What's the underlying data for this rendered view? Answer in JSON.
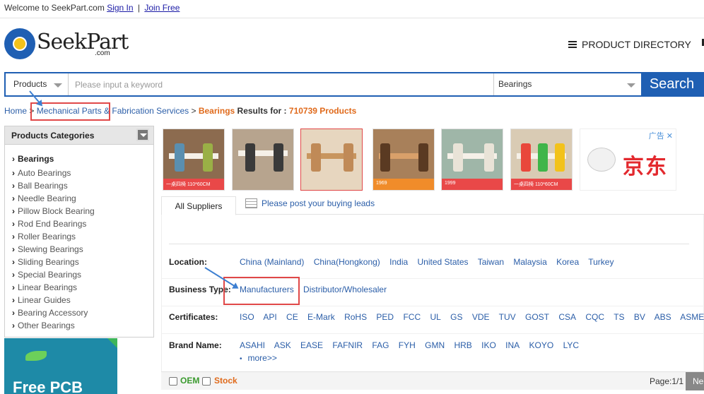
{
  "topbar": {
    "welcome": "Welcome to SeekPart.com",
    "sign_in": "Sign In",
    "sep": "|",
    "join": "Join Free"
  },
  "logo": {
    "text": "SeekPart",
    "sub": ".com"
  },
  "header": {
    "product_directory": "PRODUCT DIRECTORY"
  },
  "search": {
    "category": "Products",
    "placeholder": "Please input a keyword",
    "selected_type": "Bearings",
    "button": "Search"
  },
  "breadcrumb": {
    "home": "Home",
    "sep1": ">",
    "cat1": "Mechanical Parts & Fabrication Services",
    "sep2": ">",
    "keyword": "Bearings",
    "results_label": "Results for :",
    "count": "710739 Products"
  },
  "sidebar": {
    "heading": "Products Categories",
    "title": "Bearings",
    "items": [
      "Auto Bearings",
      "Ball Bearings",
      "Needle Bearing",
      "Pillow Block Bearing",
      "Rod End Bearings",
      "Roller Bearings",
      "Slewing Bearings",
      "Sliding Bearings",
      "Special Bearings",
      "Linear Bearings",
      "Linear Guides",
      "Bearing Accessory",
      "Other Bearings"
    ]
  },
  "promo": {
    "text": "Free PCB"
  },
  "ads": {
    "jd_label": "广告",
    "jd_close": "✕",
    "jd_name": "京东",
    "band_texts": [
      "一桌四椅 110*60CM",
      "",
      "",
      "1969",
      "1999",
      "一桌四椅 110*60CM"
    ]
  },
  "tabs": {
    "all": "All Suppliers",
    "post": "Please post your buying leads"
  },
  "filters": {
    "location": {
      "label": "Location:",
      "values": [
        "China (Mainland)",
        "China(Hongkong)",
        "India",
        "United States",
        "Taiwan",
        "Malaysia",
        "Korea",
        "Turkey"
      ]
    },
    "business": {
      "label": "Business Type:",
      "values": [
        "Manufacturers",
        "Distributor/Wholesaler"
      ]
    },
    "certificates": {
      "label": "Certificates:",
      "values": [
        "ISO",
        "API",
        "CE",
        "E-Mark",
        "RoHS",
        "PED",
        "FCC",
        "UL",
        "GS",
        "VDE",
        "TUV",
        "GOST",
        "CSA",
        "CQC",
        "TS",
        "BV",
        "ABS",
        "ASME"
      ]
    },
    "brand": {
      "label": "Brand Name:",
      "values": [
        "ASAHI",
        "ASK",
        "EASE",
        "FAFNIR",
        "FAG",
        "FYH",
        "GMN",
        "HRB",
        "IKO",
        "INA",
        "KOYO",
        "LYC"
      ],
      "more": "more>>"
    }
  },
  "bottom": {
    "oem": "OEM",
    "stock": "Stock",
    "page": "Page:1/1",
    "next": "Ne"
  },
  "colors": {
    "brand_blue": "#1f5fb3",
    "highlight_red": "#e04848",
    "link_blue": "#2b5ea8",
    "accent_orange": "#e06a1b"
  }
}
